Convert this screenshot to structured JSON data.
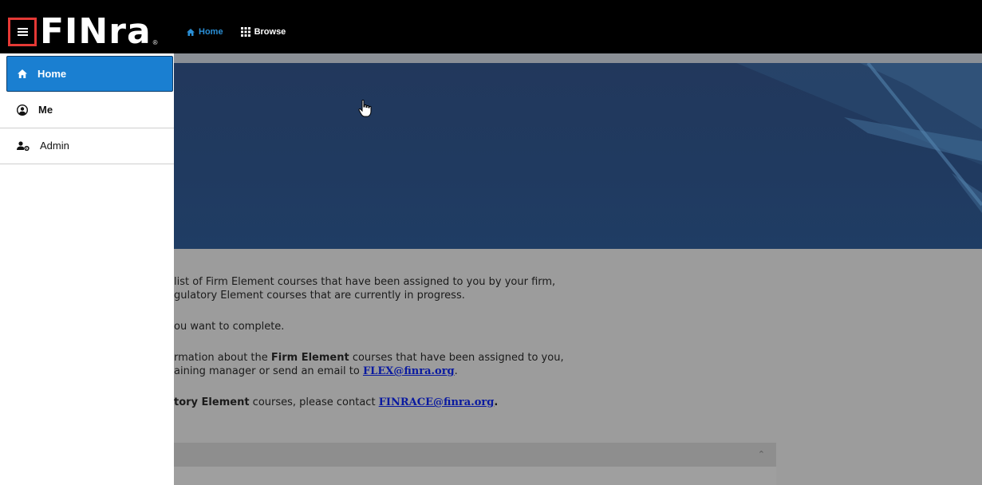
{
  "header": {
    "logo_text": "FINra",
    "logo_mark": "®",
    "nav": [
      {
        "label": "Home",
        "icon": "home-icon"
      },
      {
        "label": "Browse",
        "icon": "grid-icon"
      }
    ]
  },
  "sidebar": {
    "items": [
      {
        "label": "Home",
        "icon": "home-icon",
        "active": true
      },
      {
        "label": "Me",
        "icon": "user-circle-icon",
        "active": false
      },
      {
        "label": "Admin",
        "icon": "user-gear-icon",
        "active": false
      }
    ]
  },
  "content": {
    "para1_line1": "list of Firm Element courses that have been assigned to you by your firm,",
    "para1_line2": "gulatory Element courses that are currently in progress.",
    "para2": "ou want to complete.",
    "para3_line1_a": "rmation about the ",
    "para3_line1_bold": "Firm Element",
    "para3_line1_b": " courses that have been assigned to you,",
    "para3_line2_a": "aining manager or send an email to ",
    "para3_line2_link": "FLEX@finra.org",
    "para3_line2_b": ".",
    "para4_bold": "tory Element",
    "para4_a": " courses, please contact ",
    "para4_link": "FINRACE@finra.org",
    "para4_b": "."
  },
  "colors": {
    "accent": "#1a7fd1",
    "top_bar": "#000000",
    "highlight_border": "#e53935",
    "hero": "#203a60"
  }
}
